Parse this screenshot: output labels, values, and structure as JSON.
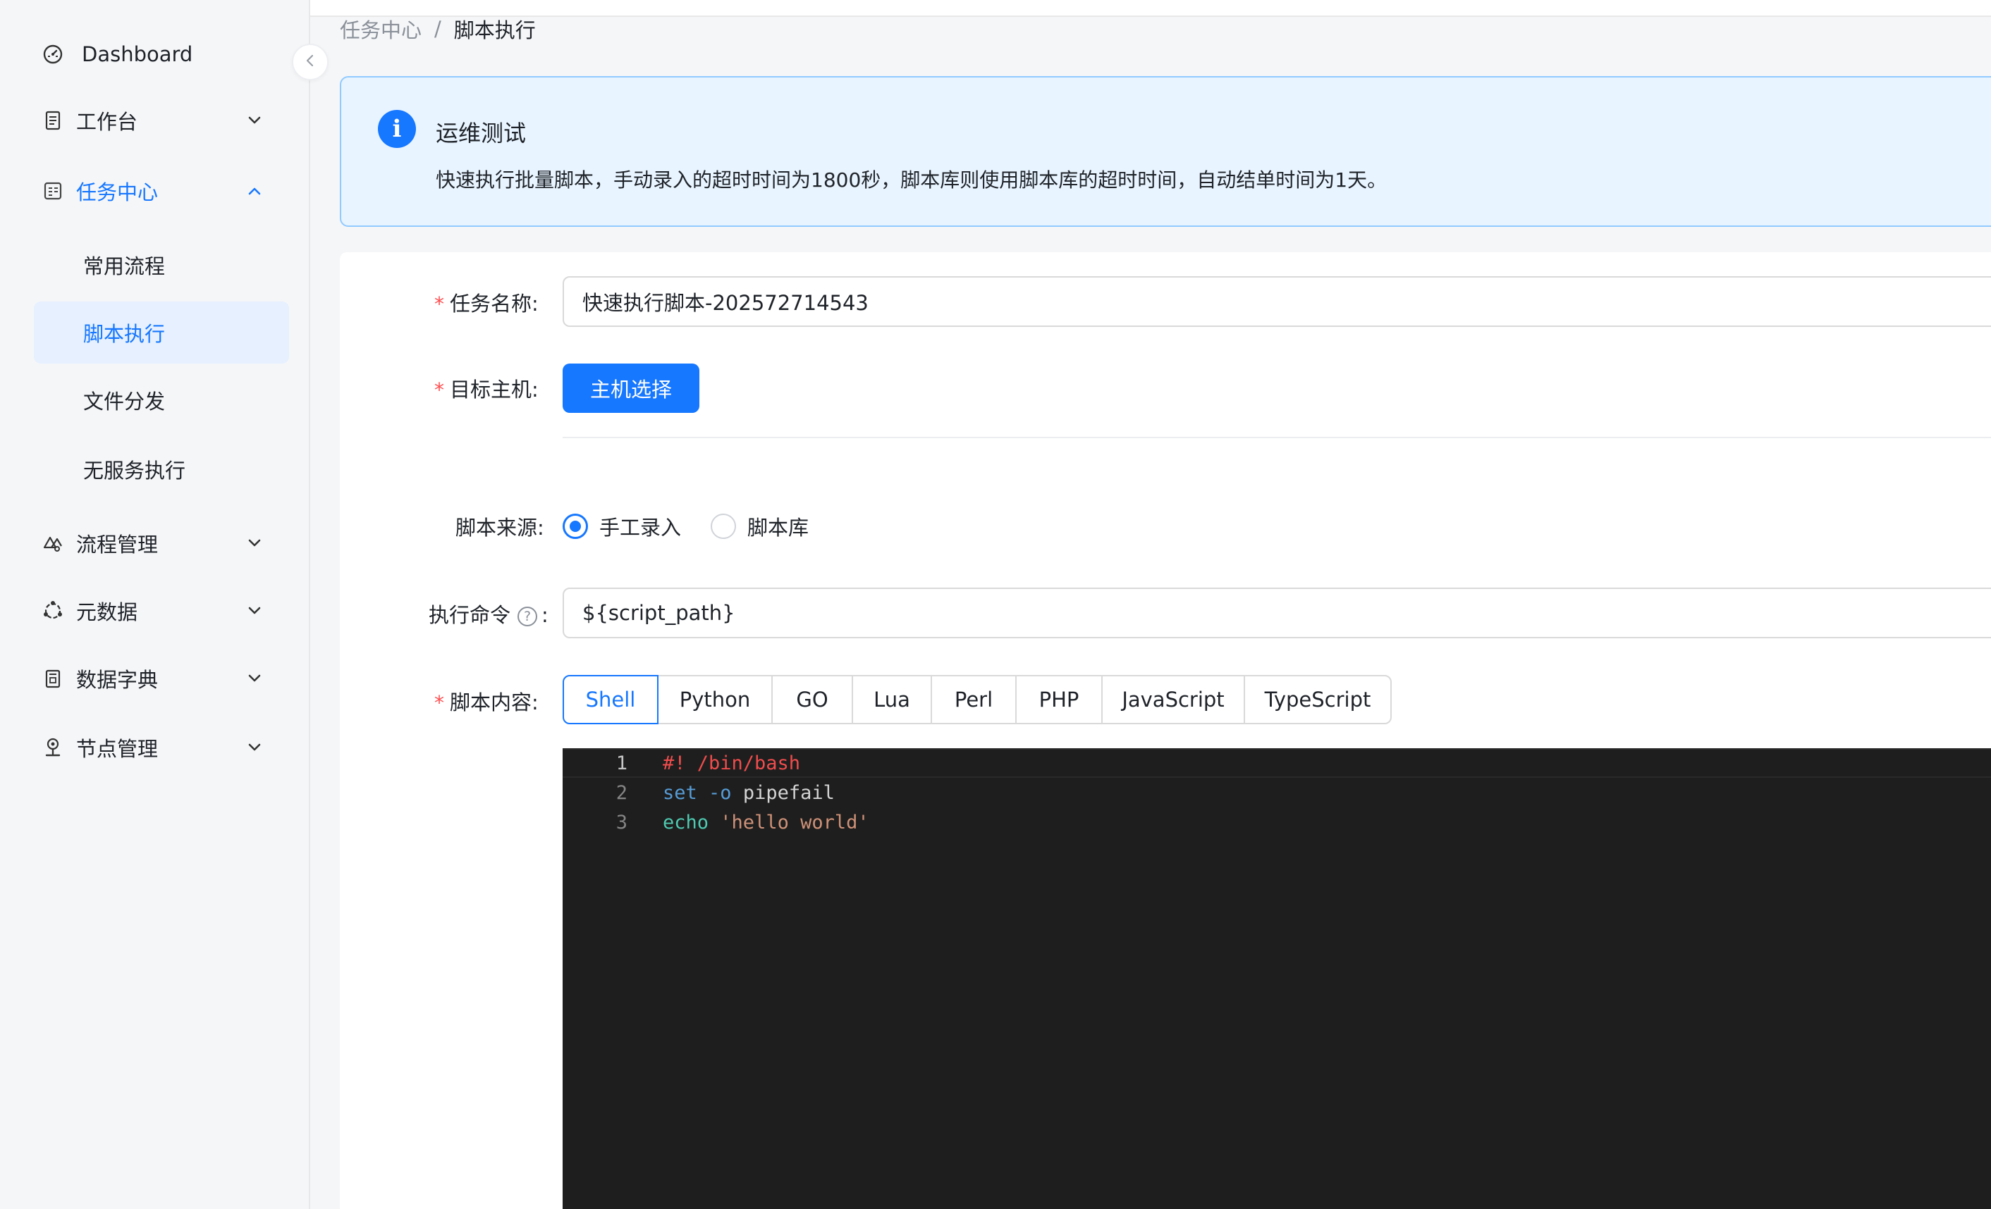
{
  "sidebar": {
    "items": [
      {
        "label": "Dashboard",
        "icon": "dashboard-icon"
      },
      {
        "label": "工作台",
        "icon": "document-icon",
        "expanded": false
      },
      {
        "label": "任务中心",
        "icon": "task-center-icon",
        "expanded": true,
        "children": [
          {
            "label": "常用流程"
          },
          {
            "label": "脚本执行",
            "selected": true
          },
          {
            "label": "文件分发"
          },
          {
            "label": "无服务执行"
          }
        ]
      },
      {
        "label": "流程管理",
        "icon": "flow-icon",
        "expanded": false
      },
      {
        "label": "元数据",
        "icon": "metadata-icon",
        "expanded": false
      },
      {
        "label": "数据字典",
        "icon": "dictionary-icon",
        "expanded": false
      },
      {
        "label": "节点管理",
        "icon": "node-icon",
        "expanded": false
      }
    ]
  },
  "breadcrumb": {
    "parent": "任务中心",
    "separator": "/",
    "current": "脚本执行"
  },
  "alert": {
    "title": "运维测试",
    "description": "快速执行批量脚本，手动录入的超时时间为1800秒，脚本库则使用脚本库的超时时间，自动结单时间为1天。"
  },
  "form": {
    "task_name": {
      "label": "任务名称:",
      "value": "快速执行脚本-202572714543",
      "required": true
    },
    "target_host": {
      "label": "目标主机:",
      "button": "主机选择",
      "required": true
    },
    "script_source": {
      "label": "脚本来源:",
      "options": [
        "手工录入",
        "脚本库"
      ],
      "selected": "手工录入"
    },
    "exec_command": {
      "label": "执行命令",
      "value": "${script_path}",
      "colon": ":"
    },
    "script_content": {
      "label": "脚本内容:",
      "required": true,
      "languages": [
        "Shell",
        "Python",
        "GO",
        "Lua",
        "Perl",
        "PHP",
        "JavaScript",
        "TypeScript"
      ],
      "active_language": "Shell"
    }
  },
  "editor": {
    "lines": [
      {
        "number": "1",
        "tokens": [
          {
            "t": "#! /bin/bash",
            "c": "comment"
          }
        ]
      },
      {
        "number": "2",
        "tokens": [
          {
            "t": "set",
            "c": "kw"
          },
          {
            "t": " ",
            "c": "plain"
          },
          {
            "t": "-o",
            "c": "kw"
          },
          {
            "t": " pipefail",
            "c": "plain"
          }
        ]
      },
      {
        "number": "3",
        "tokens": [
          {
            "t": "echo",
            "c": "cmd"
          },
          {
            "t": " ",
            "c": "plain"
          },
          {
            "t": "'hello world'",
            "c": "str"
          }
        ]
      }
    ]
  },
  "colors": {
    "primary": "#1677ff",
    "required": "#ff4d4f",
    "alert_bg": "#e8f4ff",
    "editor_bg": "#1e1e1e"
  }
}
